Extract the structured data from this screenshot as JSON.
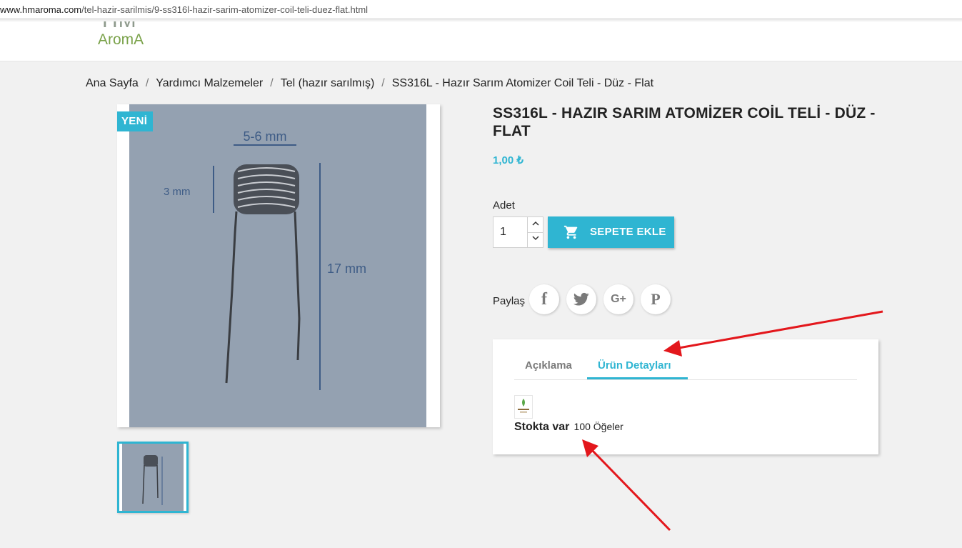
{
  "browser": {
    "url_host": "www.hmaroma.com",
    "url_path": "/tel-hazir-sarilmis/9-ss316l-hazir-sarim-atomizer-coil-teli-duez-flat.html"
  },
  "header": {
    "logo_top": "HM",
    "logo_text": "AromA"
  },
  "breadcrumb": {
    "items": [
      {
        "label": "Ana Sayfa"
      },
      {
        "label": "Yardımcı Malzemeler"
      },
      {
        "label": "Tel (hazır sarılmış)"
      },
      {
        "label": "SS316L - Hazır Sarım Atomizer Coil Teli - Düz - Flat"
      }
    ],
    "separator": "/"
  },
  "product": {
    "badge": "YENİ",
    "title": "SS316L - HAZIR SARIM ATOMİZER COİL TELİ - DÜZ - FLAT",
    "price": "1,00 ₺",
    "image_labels": {
      "width": "5-6 mm",
      "diameter": "3 mm",
      "length": "17 mm"
    },
    "quantity_label": "Adet",
    "quantity_value": "1",
    "add_to_cart": "SEPETE EKLE",
    "share_label": "Paylaş",
    "share_icons": [
      "facebook-icon",
      "twitter-icon",
      "google-plus-icon",
      "pinterest-icon"
    ],
    "share_glyphs": {
      "facebook": "f",
      "google": "G+",
      "pinterest": "P"
    }
  },
  "tabs": {
    "items": [
      {
        "label": "Açıklama",
        "active": false
      },
      {
        "label": "Ürün Detayları",
        "active": true
      }
    ],
    "stock_label": "Stokta var",
    "stock_count": "100 Öğeler"
  },
  "colors": {
    "accent": "#2fb5d2",
    "annotation_arrow": "#e3171c",
    "logo_green": "#7aa24a"
  }
}
